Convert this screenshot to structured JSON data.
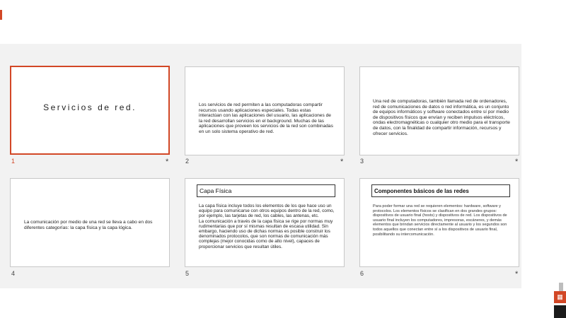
{
  "slides": [
    {
      "number": "1",
      "title": "Servicios de red."
    },
    {
      "number": "2",
      "text": "Los servicios de red permiten a las computadoras compartir recursos usando aplicaciones especiales.  Todas estas interactúan con las aplicaciones del usuario, las aplicaciones de la red desarrollan servicios en el background.  Muchas de las aplicaciones que proveen los servicios de la red son combinadas en un solo sistema operativo de red."
    },
    {
      "number": "3",
      "text": "Una red de computadoras, también llamada red de ordenadores, red de comunicaciones de datos o red informática, es un conjunto de equipos informáticos y software conectados entre sí por medio de dispositivos físicos que envían y reciben impulsos eléctricos, ondas electromagnéticas o cualquier otro medio para el transporte de datos, con la finalidad de compartir información, recursos y ofrecer servicios."
    },
    {
      "number": "4",
      "text": "La comunicación por medio de una red se lleva a cabo en dos diferentes categorías: la capa física y la capa lógica."
    },
    {
      "number": "5",
      "title": "Capa Física",
      "p1": "La capa física incluye todos los elementos de los que hace uso un equipo para comunicarse con otros equipos dentro de la red, como, por ejemplo, las tarjetas de red, los cables, las antenas, etc.",
      "p2": "La comunicación a través de la capa física se rige por normas muy rudimentarias que por sí mismas resultan de escasa utilidad. Sin embargo, haciendo uso de dichas normas es posible construir los denominados protocolos, que son normas de comunicación más complejas (mejor conocidas como de alto nivel), capaces de proporcionar servicios que resultan útiles."
    },
    {
      "number": "6",
      "title": "Componentes básicos de las redes",
      "text": "Para poder formar una red se requieren elementos: hardware, software y protocolos. Los elementos físicos se clasifican en dos grandes grupos: dispositivos de usuario final (hosts) y dispositivos de red. Los dispositivos de usuario final incluyen los computadores, impresoras, escáneres, y demás elementos que brindan servicios directamente al usuario y los segundos son todos aquellos que conectan entre sí a los dispositivos de usuario final, posibilitando su intercomunicación."
    }
  ],
  "transition_marker": "*",
  "colors": {
    "accent": "#d24726",
    "sorter_bg": "#f2f2f2"
  }
}
